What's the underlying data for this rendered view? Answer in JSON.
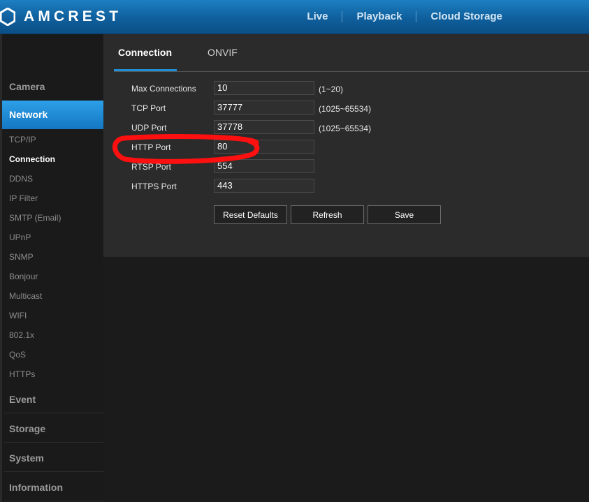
{
  "brand": {
    "name": "AMCREST"
  },
  "topnav": {
    "items": [
      "Live",
      "Playback",
      "Cloud Storage"
    ]
  },
  "sidebar": {
    "categories": {
      "camera": "Camera",
      "network": "Network",
      "event": "Event",
      "storage": "Storage",
      "system": "System",
      "information": "Information"
    },
    "network_items": [
      "TCP/IP",
      "Connection",
      "DDNS",
      "IP Filter",
      "SMTP (Email)",
      "UPnP",
      "SNMP",
      "Bonjour",
      "Multicast",
      "WIFI",
      "802.1x",
      "QoS",
      "HTTPs"
    ],
    "active_item": "Connection"
  },
  "tabs": {
    "connection": "Connection",
    "onvif": "ONVIF",
    "active": "Connection"
  },
  "form": {
    "rows": [
      {
        "label": "Max Connections",
        "value": "10",
        "range": "(1~20)"
      },
      {
        "label": "TCP Port",
        "value": "37777",
        "range": "(1025~65534)"
      },
      {
        "label": "UDP Port",
        "value": "37778",
        "range": "(1025~65534)"
      },
      {
        "label": "HTTP Port",
        "value": "80",
        "range": ""
      },
      {
        "label": "RTSP Port",
        "value": "554",
        "range": ""
      },
      {
        "label": "HTTPS Port",
        "value": "443",
        "range": ""
      }
    ]
  },
  "buttons": {
    "reset": "Reset Defaults",
    "refresh": "Refresh",
    "save": "Save"
  },
  "colors": {
    "accent": "#1f8fd8",
    "header": "#1672b5",
    "annotation": "#ff0000"
  }
}
